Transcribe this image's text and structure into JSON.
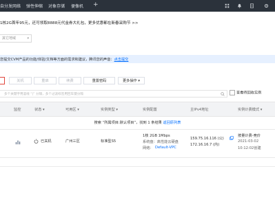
{
  "topbar": {
    "tabs": [
      "自分发网络",
      "弹性伸缩",
      "对象存储",
      "便像机"
    ],
    "add_tab": "+"
  },
  "promo": {
    "text": "1核2G首年95元，还可领取8888元代金券大礼包，更多优惠都在新春采购节 >>"
  },
  "region": {
    "label": "其它地域"
  },
  "notice": {
    "text": "您提交CVM产品的功能/体验/文档等方面的需求和建议，腾讯您的声音：",
    "link": "点击提交"
  },
  "toolbar": {
    "buttons": [
      "",
      "关机",
      "重启",
      "续费",
      "重置密码",
      "更多操作"
    ],
    "more_chev": "▾"
  },
  "search": {
    "placeholder": "多个关键字用竖线 “|” 分隔，多个过滤标签用回车键分隔",
    "checkbox_label": "查看待回收实例"
  },
  "table": {
    "headers": [
      "监控",
      "状态",
      "可用区",
      "实例类型",
      "实例配置",
      "主IPv4地址",
      "实例计费模式"
    ],
    "filter_message": "搜索 “所属项目:默认项目”，找到 1 条结果",
    "filter_link": "返回原列表",
    "row": {
      "status": "已关机",
      "zone": "广州三区",
      "type": "标准型S5",
      "config_line1": "1核 2GB 1Mbps",
      "config_line2": "系统盘：高性能云硬盘",
      "network_label": "网络：",
      "network_link": "Default-VPC",
      "ip_public": "159.75.16.116 (公)",
      "ip_private": "172.16.16.7 (内)",
      "billing": "按量计费-竞价",
      "created_date": "2021-03-02",
      "created_time": "10:12:02创建"
    }
  },
  "colors": {
    "topbar": "#2b323b",
    "accent": "#006eff",
    "notice_bg": "#e6f0ff",
    "highlight": "#e0433a"
  },
  "icons": {
    "top_right": [
      "grid-icon",
      "bell-icon",
      "doc-icon",
      "settings-icon"
    ],
    "monitor": "bar-chart-icon",
    "status": "power-icon",
    "search": "search-icon"
  }
}
